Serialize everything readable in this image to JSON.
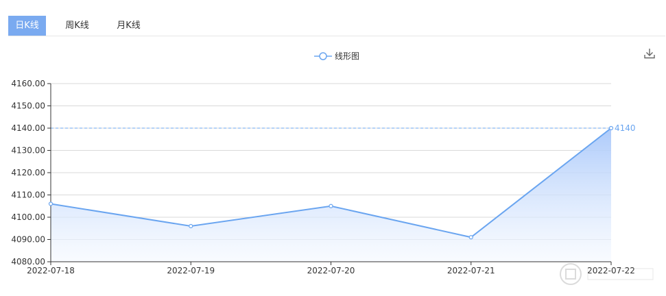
{
  "tabs": [
    {
      "label": "日K线",
      "active": true
    },
    {
      "label": "周K线",
      "active": false
    },
    {
      "label": "月K线",
      "active": false
    }
  ],
  "toolbar": {
    "download_icon": "download-icon"
  },
  "colors": {
    "line": "#6aa5f0",
    "area_top": "#a9c8fa",
    "area_bottom": "#f5f9ff",
    "grid": "#d9d9d9",
    "axis": "#333333",
    "tab_active": "#7aaaf0"
  },
  "chart_data": {
    "type": "area",
    "legend": {
      "label": "线形图",
      "position": "top-center"
    },
    "categories": [
      "2022-07-18",
      "2022-07-19",
      "2022-07-20",
      "2022-07-21",
      "2022-07-22"
    ],
    "values": [
      4106,
      4096,
      4105,
      4091,
      4140
    ],
    "ylim": [
      4080,
      4160
    ],
    "yticks": [
      "4080.00",
      "4090.00",
      "4100.00",
      "4110.00",
      "4120.00",
      "4130.00",
      "4140.00",
      "4150.00",
      "4160.00"
    ],
    "markline": {
      "value": 4140,
      "label": "4140"
    },
    "grid": true
  }
}
